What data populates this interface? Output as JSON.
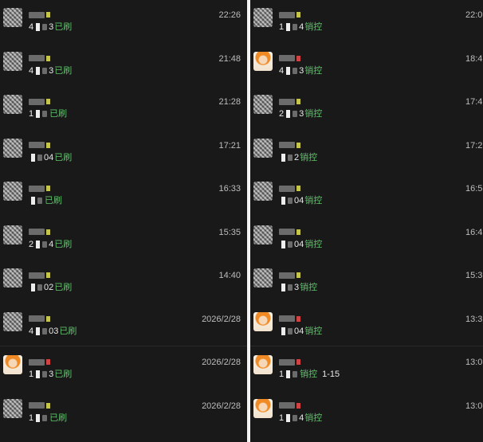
{
  "left_column": {
    "conversations": [
      {
        "avatar": "mosaic-avatar",
        "prefix": "4",
        "suffix": "3",
        "status": "已刷",
        "time": "22:26",
        "mark": "#c7c44a"
      },
      {
        "avatar": "mosaic-avatar",
        "prefix": "4",
        "suffix": "3",
        "status": "已刷",
        "time": "21:48",
        "mark": "#c7c44a"
      },
      {
        "avatar": "mosaic-avatar",
        "prefix": "1",
        "suffix": "",
        "status": "已刷",
        "time": "21:28",
        "mark": "#c7c44a"
      },
      {
        "avatar": "mosaic-avatar",
        "prefix": "",
        "suffix": "04",
        "status": "已刷",
        "time": "17:21",
        "mark": "#c7c44a"
      },
      {
        "avatar": "mosaic-avatar",
        "prefix": "",
        "suffix": "",
        "status": "已刷",
        "time": "16:33",
        "mark": "#c7c44a"
      },
      {
        "avatar": "mosaic-avatar",
        "prefix": "2",
        "suffix": "4",
        "status": "已刷",
        "time": "15:35",
        "mark": "#c7c44a"
      },
      {
        "avatar": "mosaic-avatar",
        "prefix": "",
        "suffix": "02",
        "status": "已刷",
        "time": "14:40",
        "mark": "#c7c44a"
      },
      {
        "avatar": "mosaic-avatar",
        "prefix": "4",
        "suffix": "03",
        "status": "已刷",
        "time": "2026/2/28",
        "mark": "#c7c44a"
      },
      {
        "avatar": "orange-avatar",
        "prefix": "1",
        "suffix": "3",
        "status": "已刷",
        "time": "2026/2/28",
        "mark": "#d24242"
      },
      {
        "avatar": "mosaic-avatar",
        "prefix": "1",
        "suffix": "",
        "status": "已刷",
        "time": "2026/2/28",
        "mark": "#c7c44a"
      }
    ]
  },
  "right_column": {
    "conversations": [
      {
        "avatar": "mosaic-avatar",
        "prefix": "1",
        "suffix": "4",
        "status": "销控",
        "extra": "",
        "time": "22:0",
        "mark": "#c7c44a"
      },
      {
        "avatar": "orange-avatar",
        "prefix": "4",
        "suffix": "3",
        "status": "销控",
        "extra": "",
        "time": "18:4",
        "mark": "#d24242"
      },
      {
        "avatar": "mosaic-avatar",
        "prefix": "2",
        "suffix": "3",
        "status": "销控",
        "extra": "",
        "time": "17:4",
        "mark": "#c7c44a"
      },
      {
        "avatar": "mosaic-avatar",
        "prefix": "",
        "suffix": "2",
        "status": "销控",
        "extra": "",
        "time": "17:2",
        "mark": "#c7c44a"
      },
      {
        "avatar": "mosaic-avatar",
        "prefix": "",
        "suffix": "04",
        "status": "销控",
        "extra": "",
        "time": "16:5",
        "mark": "#c7c44a"
      },
      {
        "avatar": "mosaic-avatar",
        "prefix": "",
        "suffix": "04",
        "status": "销控",
        "extra": "",
        "time": "16:4",
        "mark": "#c7c44a"
      },
      {
        "avatar": "mosaic-avatar",
        "prefix": "",
        "suffix": "3",
        "status": "销控",
        "extra": "",
        "time": "15:3",
        "mark": "#c7c44a"
      },
      {
        "avatar": "orange-avatar",
        "prefix": "",
        "suffix": "04",
        "status": "销控",
        "extra": "",
        "time": "13:3",
        "mark": "#d24242"
      },
      {
        "avatar": "orange-avatar",
        "prefix": "1",
        "suffix": "",
        "status": "销控",
        "extra": "1-15",
        "time": "13:0",
        "mark": "#d24242"
      },
      {
        "avatar": "orange-avatar",
        "prefix": "1",
        "suffix": "4",
        "status": "销控",
        "extra": "",
        "time": "13:0",
        "mark": "#d24242"
      }
    ]
  },
  "colors": {
    "background": "#191919",
    "status_green": "#5ec16a",
    "time_gray": "#bdbdbd"
  }
}
